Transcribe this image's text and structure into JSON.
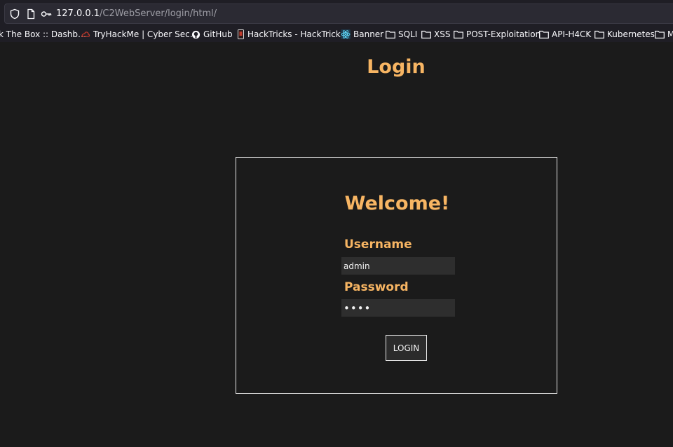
{
  "browser": {
    "url_host": "127.0.0.1",
    "url_path": "/C2WebServer/login/html/"
  },
  "bookmarks": [
    {
      "label": "k The Box :: Dashb…",
      "icon": "none"
    },
    {
      "label": "TryHackMe | Cyber Sec…",
      "icon": "tryhackme-icon"
    },
    {
      "label": "GitHub",
      "icon": "github-icon"
    },
    {
      "label": "HackTricks - HackTricks",
      "icon": "hacktricks-icon"
    },
    {
      "label": "Banner",
      "icon": "react-icon"
    },
    {
      "label": "SQLI",
      "icon": "folder-icon"
    },
    {
      "label": "XSS",
      "icon": "folder-icon"
    },
    {
      "label": "POST-Exploitation",
      "icon": "folder-icon"
    },
    {
      "label": "API-H4CK",
      "icon": "folder-icon"
    },
    {
      "label": "Kubernetes",
      "icon": "folder-icon"
    },
    {
      "label": "M",
      "icon": "folder-icon"
    }
  ],
  "page": {
    "title": "Login",
    "welcome": "Welcome!",
    "username_label": "Username",
    "username_value": "admin",
    "password_label": "Password",
    "password_value": "••••",
    "login_button": "LOGIN"
  },
  "colors": {
    "accent": "#f7b563",
    "background": "#1b1b1b",
    "input_bg": "#2e2e2e"
  }
}
